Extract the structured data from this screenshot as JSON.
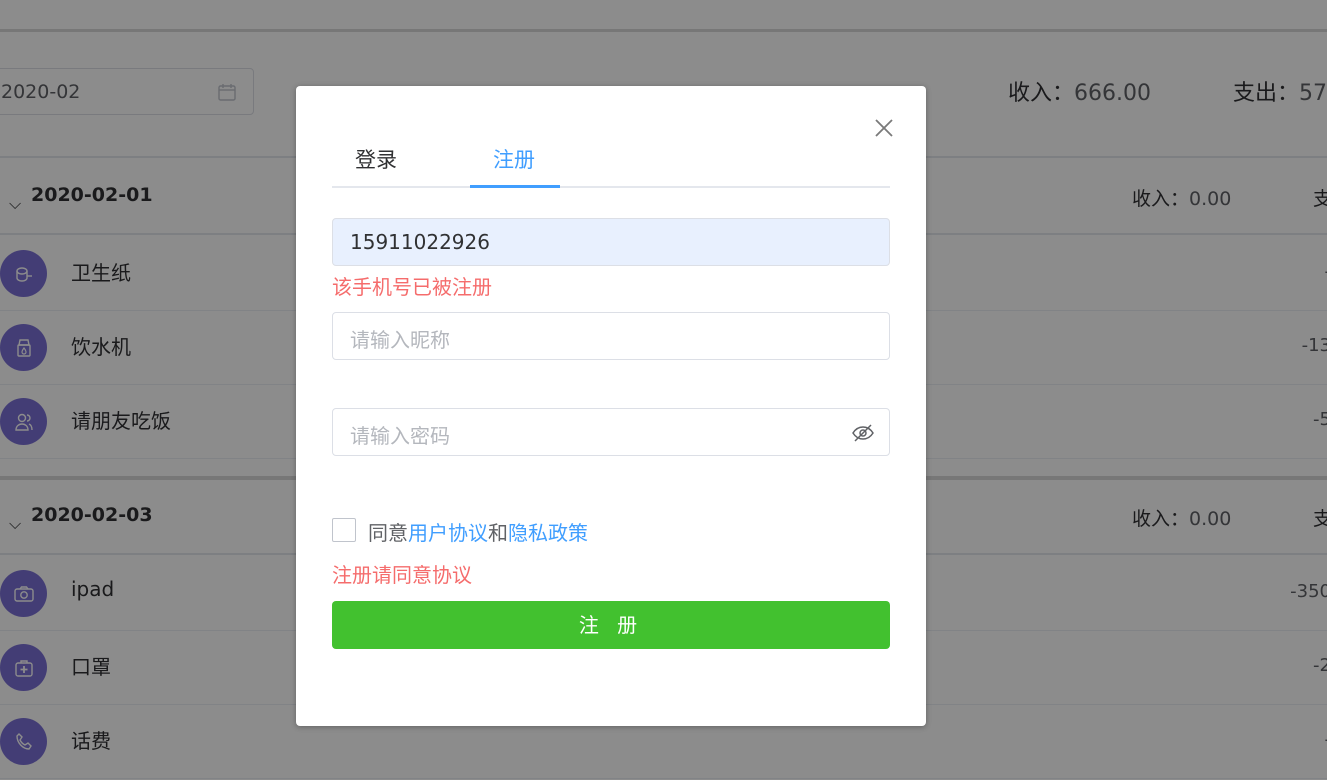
{
  "background": {
    "month_value": "2020-02",
    "income_label": "收入：",
    "income_value": "666.00",
    "expense_label": "支出：",
    "expense_value": "57",
    "groups": [
      {
        "date": "2020-02-01",
        "income_label": "收入：",
        "income_value": "0.00",
        "expense_label": "支",
        "items": [
          {
            "name": "卫生纸",
            "amount": "-",
            "icon": "toilet-paper-icon"
          },
          {
            "name": "饮水机",
            "amount": "-13",
            "icon": "water-dispenser-icon"
          },
          {
            "name": "请朋友吃饭",
            "amount": "-5",
            "icon": "friends-icon"
          }
        ]
      },
      {
        "date": "2020-02-03",
        "income_label": "收入：",
        "income_value": "0.00",
        "expense_label": "支",
        "items": [
          {
            "name": "ipad",
            "amount": "-350",
            "icon": "camera-icon"
          },
          {
            "name": "口罩",
            "amount": "-2",
            "icon": "medkit-icon"
          },
          {
            "name": "话费",
            "amount": "-",
            "icon": "phone-icon"
          }
        ]
      }
    ]
  },
  "dialog": {
    "tabs": [
      {
        "label": "登录",
        "active": false
      },
      {
        "label": "注册",
        "active": true
      }
    ],
    "phone": {
      "value": "15911022926"
    },
    "phone_error": "该手机号已被注册",
    "nickname": {
      "placeholder": "请输入昵称"
    },
    "password": {
      "placeholder": "请输入密码"
    },
    "agree": {
      "prefix": "同意",
      "user_agreement": "用户协议",
      "and": "和",
      "privacy_policy": "隐私政策",
      "checked": false
    },
    "agree_error": "注册请同意协议",
    "submit_label": "注 册",
    "colors": {
      "accent": "#409eff",
      "submit": "#42c12f",
      "error": "#f56c6c",
      "avatar": "#7b6fd6"
    }
  }
}
